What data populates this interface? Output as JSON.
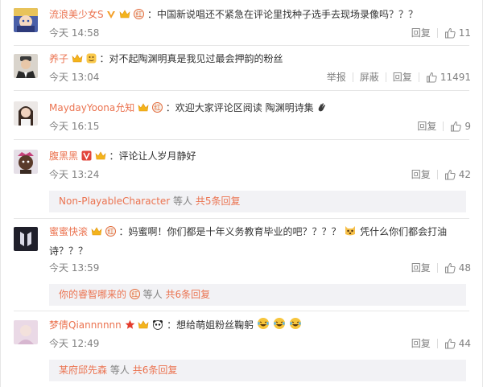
{
  "comments": [
    {
      "user": "流浪美少女S",
      "text": "：中国新说唱还不紧急在评论里找种子选手去现场录像吗？？？",
      "time": "今天 14:58",
      "actions": [
        "回复"
      ],
      "likes": "11",
      "avatar_icon": "anime-avatar"
    },
    {
      "user": "养子",
      "text": "：对不起陶渊明真是我见过最会押韵的粉丝",
      "time": "今天 13:04",
      "actions": [
        "举报",
        "屏蔽",
        "回复"
      ],
      "likes": "11491",
      "avatar_icon": "man-avatar"
    },
    {
      "user": "MaydayYoona允知",
      "text": "：欢迎大家评论区阅读 陶渊明诗集",
      "time": "今天 16:15",
      "actions": [
        "回复"
      ],
      "likes": "9",
      "avatar_icon": "woman-avatar"
    },
    {
      "user": "腹黑黑",
      "text": "：评论让人岁月静好",
      "time": "今天 13:24",
      "actions": [
        "回复"
      ],
      "likes": "42",
      "avatar_icon": "dark-avatar",
      "replies": {
        "user": "Non-PlayableCharacter",
        "label": "等人",
        "count": "共5条回复"
      }
    },
    {
      "user": "蜜蜜快滚",
      "text": "：妈蜜啊！你们都是十年义务教育毕业的吧？？？？",
      "text2": "凭什么你们都会打油",
      "text3": "诗？？？",
      "time": "今天 13:59",
      "actions": [
        "回复"
      ],
      "likes": "48",
      "avatar_icon": "logo-avatar",
      "replies": {
        "user": "你的睿智哪来的",
        "label": "等人",
        "count": "共6条回复"
      }
    },
    {
      "user": "梦倩Qiannnnnn",
      "text": "：想给萌姐粉丝鞠躬",
      "time": "今天 12:49",
      "actions": [
        "回复"
      ],
      "likes": "44",
      "avatar_icon": "pink-avatar",
      "replies": {
        "user": "某府邱先森",
        "label": "等人",
        "count": "共6条回复"
      }
    }
  ],
  "colors": {
    "username": "#eb7350",
    "meta": "#808080",
    "reply_bg": "#f2f2f5"
  }
}
